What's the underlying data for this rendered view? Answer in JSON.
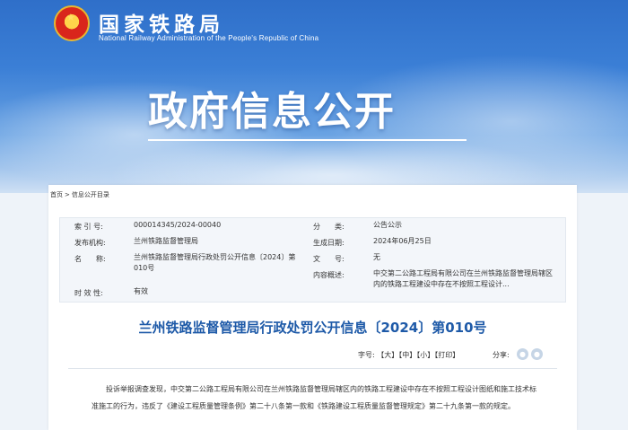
{
  "header": {
    "org_cn": "国家铁路局",
    "org_en": "National Railway Administration of the People's Republic of China",
    "banner_title": "政府信息公开"
  },
  "breadcrumb": {
    "home": "首页",
    "separator": ">",
    "current": "信息公开目录"
  },
  "meta": {
    "index_label": "索 引 号:",
    "index_value": "000014345/2024-00040",
    "category_label": "分　　类:",
    "category_value": "公告公示",
    "issuer_label": "发布机构:",
    "issuer_value": "兰州铁路监督管理局",
    "date_label": "生成日期:",
    "date_value": "2024年06月25日",
    "name_label": "名　　称:",
    "name_value": "兰州铁路监督管理局行政处罚公开信息〔2024〕第010号",
    "docno_label": "文　　号:",
    "docno_value": "无",
    "summary_label": "内容概述:",
    "summary_value": "中交第二公路工程局有限公司在兰州铁路监督管理局辖区内的铁路工程建设中存在不按照工程设计...",
    "validity_label": "时 效 性:",
    "validity_value": "有效"
  },
  "article": {
    "title": "兰州铁路监督管理局行政处罚公开信息〔2024〕第010号",
    "font_size_label": "字号:",
    "size_large": "【大】",
    "size_medium": "【中】",
    "size_small": "【小】",
    "print": "【打印】",
    "share_label": "分享:",
    "body": "投诉举报调查发现，中交第二公路工程局有限公司在兰州铁路监督管理局辖区内的铁路工程建设中存在不按照工程设计图纸和施工技术标准施工的行为，违反了《建设工程质量管理条例》第二十八条第一款和《铁路建设工程质量监督管理规定》第二十九条第一款的规定。"
  },
  "colors": {
    "title_blue": "#1e5aa8",
    "hero_blue": "#2f6fc9"
  },
  "icons": [
    "national-emblem-icon",
    "wechat-icon",
    "weibo-icon"
  ]
}
